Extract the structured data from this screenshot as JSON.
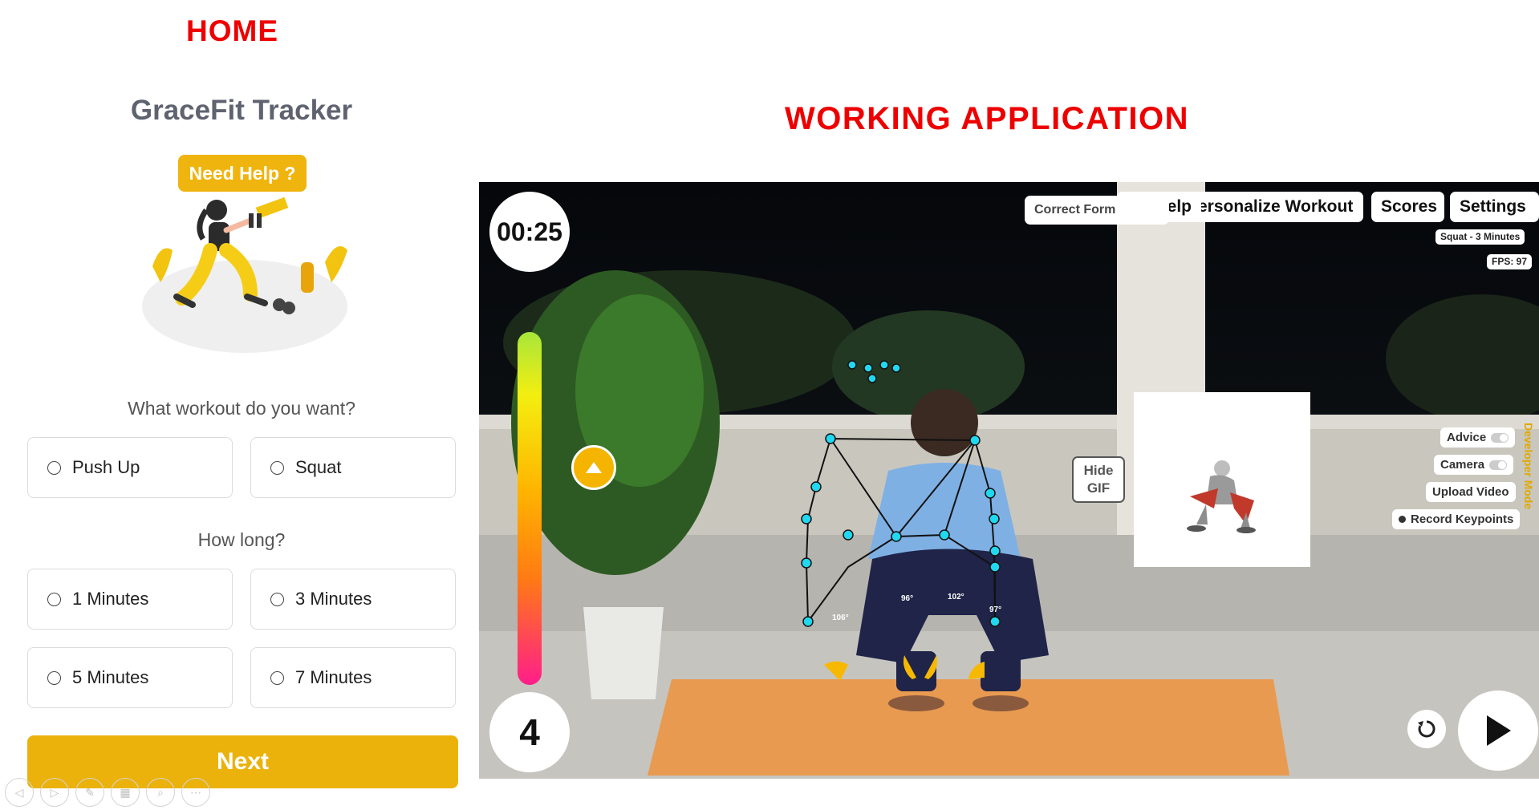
{
  "captions": {
    "home": "HOME",
    "app": "WORKING APPLICATION"
  },
  "home": {
    "title": "GraceFit Tracker",
    "help_badge": "Need Help ?",
    "workout_question": "What workout do you want?",
    "workout_options": [
      {
        "label": "Push Up",
        "selected": false
      },
      {
        "label": "Squat",
        "selected": false
      }
    ],
    "duration_question": "How long?",
    "duration_options": [
      {
        "label": "1 Minutes",
        "selected": false
      },
      {
        "label": "3 Minutes",
        "selected": false
      },
      {
        "label": "5 Minutes",
        "selected": false
      },
      {
        "label": "7 Minutes",
        "selected": false
      }
    ],
    "next_label": "Next",
    "accent_color": "#ebb20c"
  },
  "app": {
    "timer": "00:25",
    "rep_count": "4",
    "toolbar": {
      "correct_form": "Correct Form",
      "help": "Help",
      "personalize": "Personalize Workout",
      "scores": "Scores",
      "settings": "Settings"
    },
    "session_label": "Squat - 3 Minutes",
    "fps_label": "FPS: 97",
    "hide_gif_line1": "Hide",
    "hide_gif_line2": "GIF",
    "controls": {
      "advice": "Advice",
      "camera": "Camera",
      "upload_video": "Upload Video",
      "record_keypoints": "Record Keypoints",
      "developer_mode": "Developer Mode"
    },
    "pose_angles": [
      "96°",
      "102°",
      "106°",
      "97°"
    ],
    "progress_level": 0.0,
    "skeleton_color": "#20d8f0",
    "icons": [
      "up-arrow-icon",
      "reset-icon",
      "play-icon"
    ]
  }
}
